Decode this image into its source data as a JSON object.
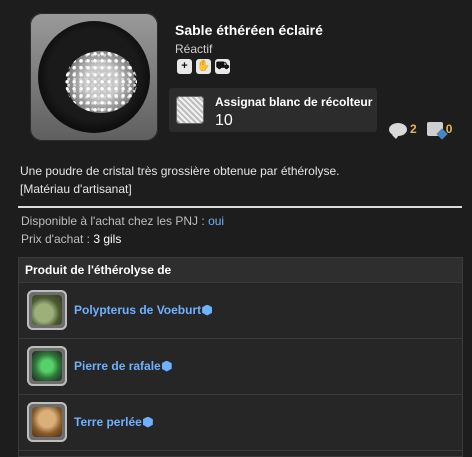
{
  "item": {
    "name": "Sable éthéréen éclairé",
    "type": "Réactif",
    "icon": "sand-plate-icon",
    "badges": [
      {
        "icon": "shield-plus-icon",
        "glyph": "+"
      },
      {
        "icon": "hand-icon",
        "glyph": "✋"
      },
      {
        "icon": "cart-icon",
        "glyph": "⛟"
      }
    ]
  },
  "currency": {
    "icon": "white-gatherer-scrip-icon",
    "name": "Assignat blanc de récolteur",
    "count": "10"
  },
  "counts": {
    "comments": "2",
    "notes": "0"
  },
  "description": {
    "line1": "Une poudre de cristal très grossière obtenue par éthérolyse.",
    "line2": "[Matériau d'artisanat]"
  },
  "vendor": {
    "label": "Disponible à l'achat chez les PNJ : ",
    "available": "oui",
    "price_label": "Prix d'achat : ",
    "price": "3 gils"
  },
  "table": {
    "header": "Produit de l'éthérolyse de",
    "rows": [
      {
        "name": "Polypterus de Voeburt",
        "icon": "fish-icon"
      },
      {
        "name": "Pierre de rafale",
        "icon": "green-rock-icon"
      },
      {
        "name": "Terre perlée",
        "icon": "soil-bowl-icon"
      }
    ]
  },
  "colors": {
    "link": "#6fb1ff",
    "count": "#e6b84a",
    "background": "#1d1d1d"
  }
}
